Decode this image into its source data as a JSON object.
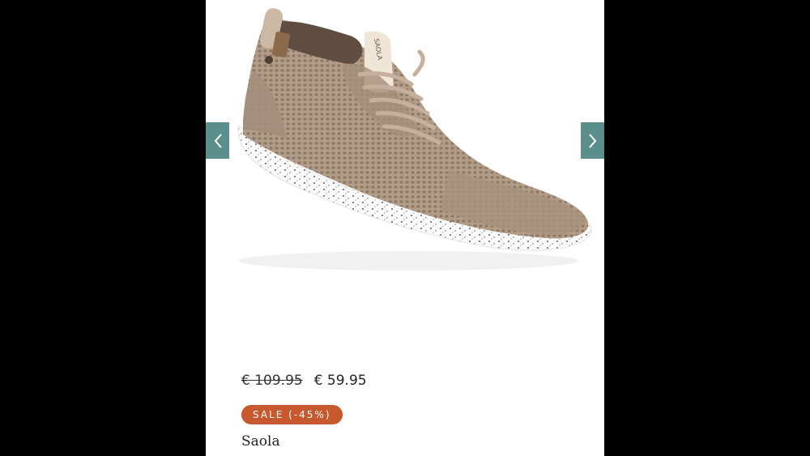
{
  "product": {
    "old_price": "€ 109.95",
    "new_price": "€ 59.95",
    "sale_badge": "SALE (-45%)",
    "brand": "Saola",
    "tongue_label": "SAOLA"
  },
  "colors": {
    "arrow_bg": "#5b8f8b",
    "badge_bg": "#c8592f",
    "shoe_knit": "#b09a86",
    "sole": "#ffffff"
  },
  "icons": {
    "prev": "chevron-left-icon",
    "next": "chevron-right-icon"
  }
}
